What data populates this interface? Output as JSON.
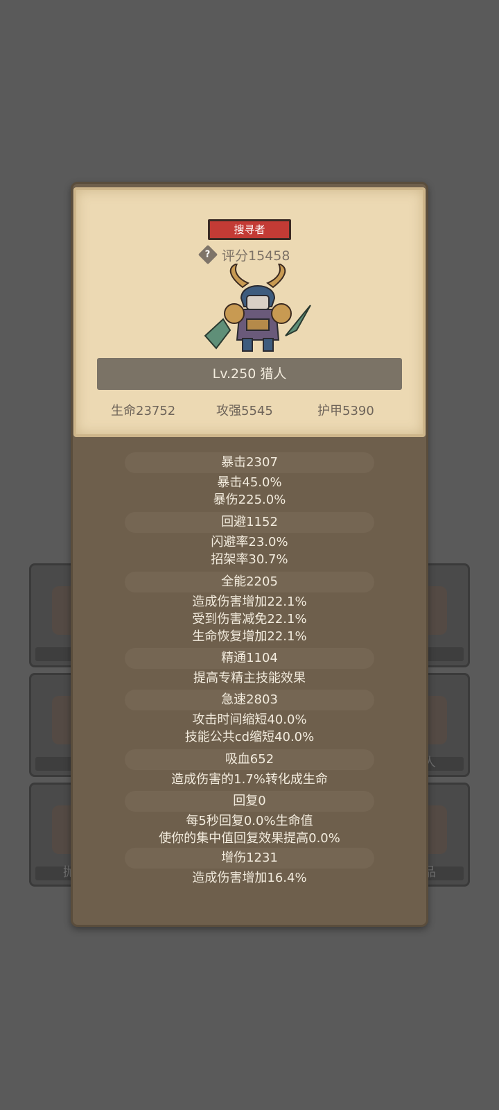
{
  "background_cards": {
    "fragment_left": "抛",
    "fragment_right_1": "人",
    "fragment_right_2": "品"
  },
  "header": {
    "class_badge": "搜寻者",
    "score_label": "评分15458",
    "help_icon": "?",
    "level_title": "Lv.250 猎人",
    "stats": {
      "hp": "生命23752",
      "attack": "攻强5545",
      "armor": "护甲5390"
    }
  },
  "details": [
    {
      "title": "暴击2307",
      "lines": [
        "暴击45.0%",
        "暴伤225.0%"
      ]
    },
    {
      "title": "回避1152",
      "lines": [
        "闪避率23.0%",
        "招架率30.7%"
      ]
    },
    {
      "title": "全能2205",
      "lines": [
        "造成伤害增加22.1%",
        "受到伤害减免22.1%",
        "生命恢复增加22.1%"
      ]
    },
    {
      "title": "精通1104",
      "lines": [
        "提高专精主技能效果"
      ]
    },
    {
      "title": "急速2803",
      "lines": [
        "攻击时间缩短40.0%",
        "技能公共cd缩短40.0%"
      ]
    },
    {
      "title": "吸血652",
      "lines": [
        "造成伤害的1.7%转化成生命"
      ]
    },
    {
      "title": "回复0",
      "lines": [
        "每5秒回复0.0%生命值",
        "使你的集中值回复效果提高0.0%"
      ]
    },
    {
      "title": "增伤1231",
      "lines": [
        "造成伤害增加16.4%"
      ]
    }
  ],
  "colors": {
    "background": "#5a5a5a",
    "panel": "#6e5f4c",
    "parchment": "#ecd9b3",
    "badge": "#c33b35",
    "text_light": "#f2ebdd"
  }
}
